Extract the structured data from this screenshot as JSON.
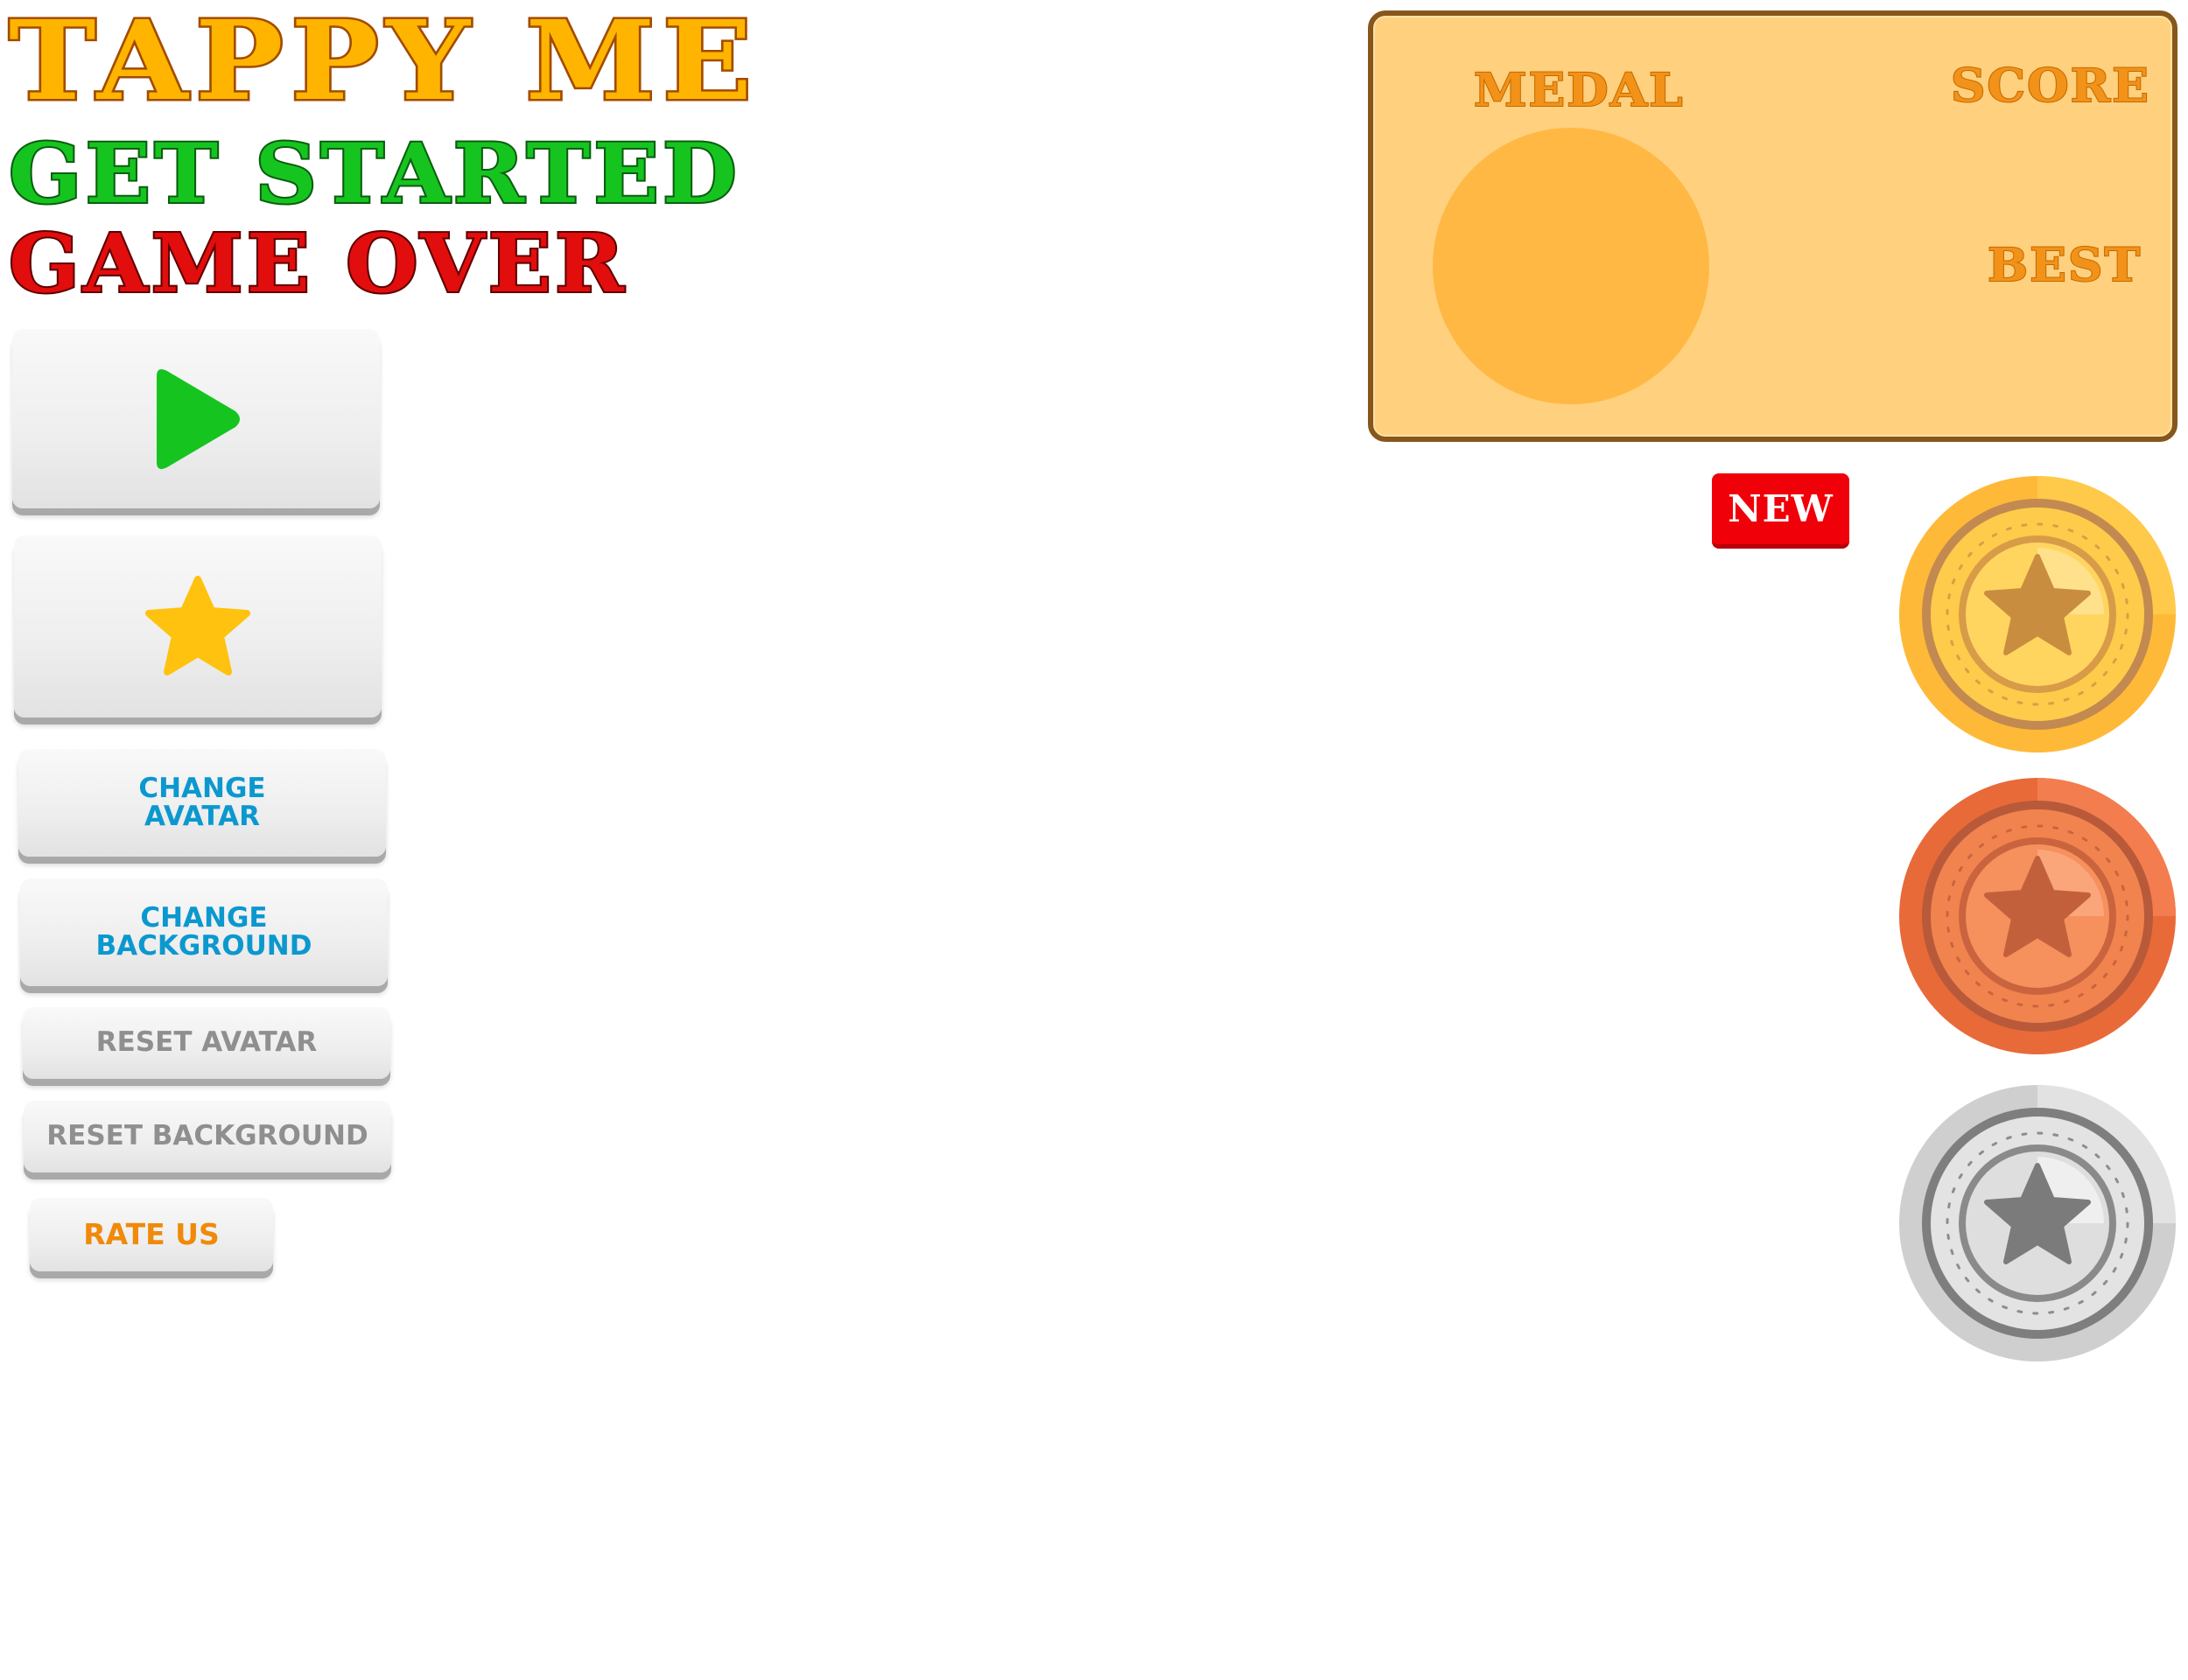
{
  "titles": {
    "main": "TAPPY ME",
    "start": "GET STARTED",
    "over": "GAME OVER"
  },
  "buttons": {
    "play_icon": "play-icon",
    "star_icon": "star-icon",
    "change_avatar": "CHANGE\nAVATAR",
    "change_background": "CHANGE\nBACKGROUND",
    "reset_avatar": "RESET AVATAR",
    "reset_background": "RESET BACKGROUND",
    "rate_us": "RATE US"
  },
  "score_panel": {
    "medal_label": "MEDAL",
    "score_label": "SCORE",
    "best_label": "BEST"
  },
  "badge": {
    "new_label": "NEW"
  },
  "medals": [
    {
      "name": "gold-medal",
      "icon": "star-icon"
    },
    {
      "name": "bronze-medal",
      "icon": "star-icon"
    },
    {
      "name": "silver-medal",
      "icon": "star-icon"
    }
  ],
  "colors": {
    "title_main": "#ffb500",
    "title_start": "#16c41f",
    "title_over": "#e20d0d",
    "play_green": "#16c41f",
    "star_yellow": "#ffc20e",
    "label_blue": "#0b98cf",
    "label_gray": "#8f8f8f",
    "label_orange": "#ef8a0a",
    "panel_fill": "#ffd07e",
    "panel_border": "#86561c",
    "badge_red": "#f00009",
    "gold": "#ffc13a",
    "bronze": "#ef7845",
    "silver": "#dcdcdc"
  }
}
